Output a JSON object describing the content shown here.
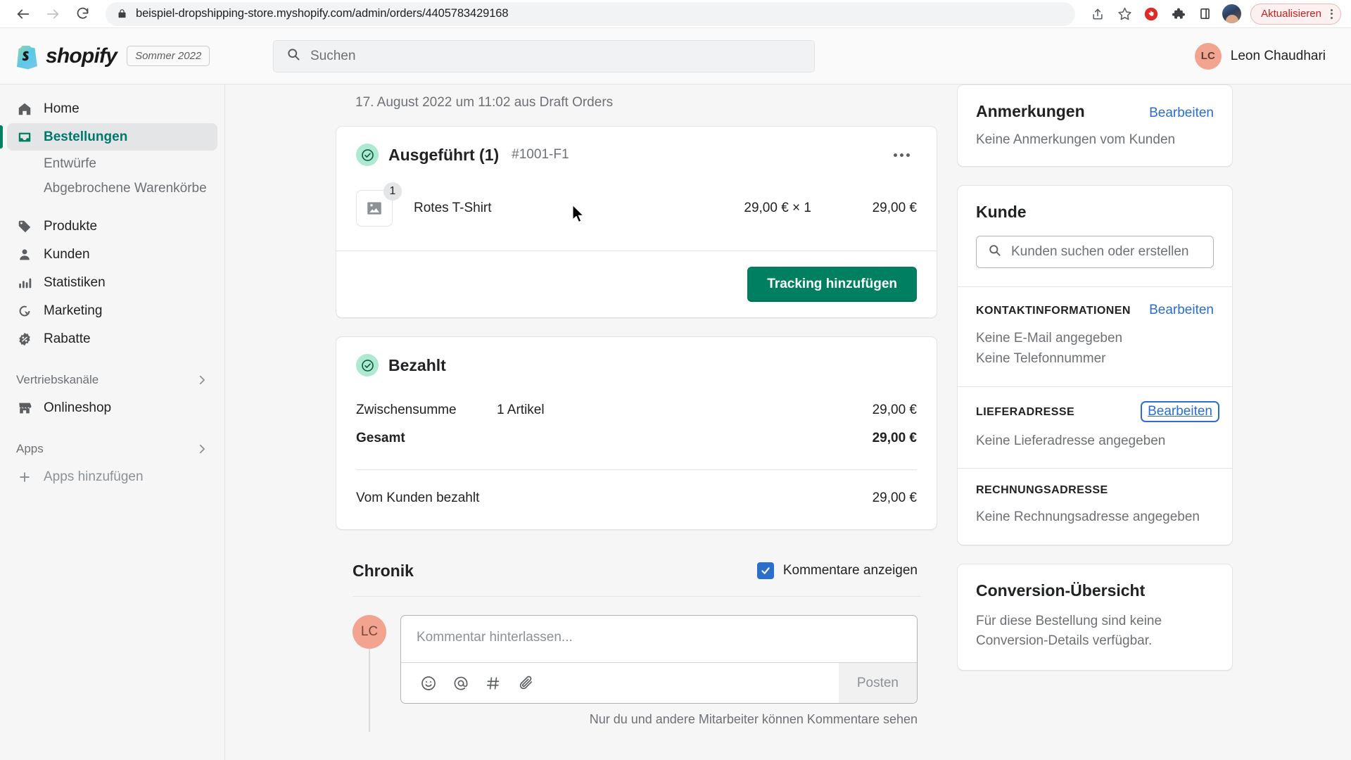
{
  "browser": {
    "url": "beispiel-dropshipping-store.myshopify.com/admin/orders/4405783429168",
    "back_label": "back-arrow",
    "forward_label": "forward-arrow",
    "reload_label": "reload",
    "update_button": "Aktualisieren"
  },
  "topbar": {
    "wordmark": "shopify",
    "season_chip": "Sommer 2022",
    "search_placeholder": "Suchen",
    "user_initials": "LC",
    "user_name": "Leon Chaudhari"
  },
  "sidebar": {
    "items": [
      {
        "label": "Home",
        "icon": "home-icon",
        "active": false
      },
      {
        "label": "Bestellungen",
        "icon": "orders-icon",
        "active": true
      }
    ],
    "sub_items": [
      {
        "label": "Entwürfe"
      },
      {
        "label": "Abgebrochene Warenkörbe"
      }
    ],
    "items2": [
      {
        "label": "Produkte",
        "icon": "tag-icon"
      },
      {
        "label": "Kunden",
        "icon": "person-icon"
      },
      {
        "label": "Statistiken",
        "icon": "bars-icon"
      },
      {
        "label": "Marketing",
        "icon": "target-icon"
      },
      {
        "label": "Rabatte",
        "icon": "discount-icon"
      }
    ],
    "group_channels": "Vertriebskanäle",
    "channel_item": {
      "label": "Onlineshop",
      "icon": "store-icon"
    },
    "group_apps": "Apps",
    "apps_item": {
      "label": "Apps hinzufügen",
      "icon": "plus-icon"
    }
  },
  "order": {
    "meta": "17. August 2022 um 11:02 aus Draft Orders",
    "fulfillment": {
      "title": "Ausgeführt (1)",
      "reference": "#1001-F1",
      "status_icon": "check-circle-icon",
      "menu_icon": "ellipsis-icon",
      "line_item": {
        "name": "Rotes T-Shirt",
        "quantity_badge": "1",
        "unit_price": "29,00 € × 1",
        "total_price": "29,00 €",
        "thumb_icon": "image-placeholder-icon"
      },
      "action_button": "Tracking hinzufügen"
    },
    "payment": {
      "title": "Bezahlt",
      "status_icon": "check-circle-icon",
      "rows": [
        {
          "label": "Zwischensumme",
          "detail": "1 Artikel",
          "value": "29,00 €",
          "bold": false
        },
        {
          "label": "Gesamt",
          "detail": "",
          "value": "29,00 €",
          "bold": true
        }
      ],
      "paid_row": {
        "label": "Vom Kunden bezahlt",
        "value": "29,00 €"
      }
    },
    "timeline": {
      "title": "Chronik",
      "show_comments_label": "Kommentare anzeigen",
      "show_comments_checked": true,
      "avatar_initials": "LC",
      "comment_placeholder": "Kommentar hinterlassen...",
      "toolbar_icons": [
        "emoji-icon",
        "mention-icon",
        "hashtag-icon",
        "attachment-icon"
      ],
      "post_button": "Posten",
      "note": "Nur du und andere Mitarbeiter können Kommentare sehen"
    }
  },
  "side_panels": {
    "notes": {
      "title": "Anmerkungen",
      "edit_link": "Bearbeiten",
      "body": "Keine Anmerkungen vom Kunden"
    },
    "customer": {
      "title": "Kunde",
      "search_placeholder": "Kunden suchen oder erstellen",
      "contact": {
        "heading": "KONTAKTINFORMATIONEN",
        "edit_link": "Bearbeiten",
        "line1": "Keine E-Mail angegeben",
        "line2": "Keine Telefonnummer"
      },
      "shipping": {
        "heading": "LIEFERADRESSE",
        "edit_link": "Bearbeiten",
        "line1": "Keine Lieferadresse angegeben"
      },
      "billing": {
        "heading": "RECHNUNGSADRESSE",
        "line1": "Keine Rechnungsadresse angegeben"
      }
    },
    "conversion": {
      "title": "Conversion-Übersicht",
      "body": "Für diese Bestellung sind keine Conversion-Details verfügbar."
    }
  },
  "colors": {
    "shopify_green": "#008060",
    "link_blue": "#2c6ecb",
    "success_bg": "#aee9d1",
    "checkbox_blue": "#2c6ecb"
  }
}
